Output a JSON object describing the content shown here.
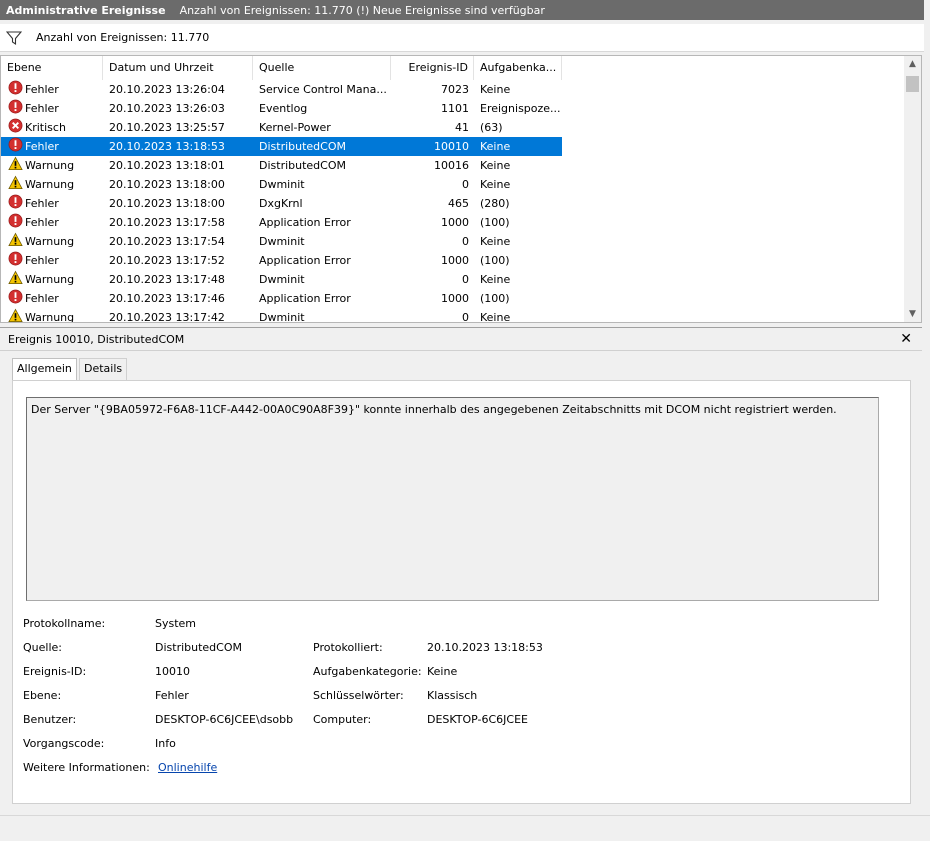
{
  "title": {
    "name": "Administrative Ereignisse",
    "info": "Anzahl von Ereignissen: 11.770 (!) Neue Ereignisse sind verfügbar"
  },
  "filter": {
    "icon": "filter-icon",
    "text": "Anzahl von Ereignissen: 11.770"
  },
  "columns": [
    "Ebene",
    "Datum und Uhrzeit",
    "Quelle",
    "Ereignis-ID",
    "Aufgabenka..."
  ],
  "rows": [
    {
      "level": "Fehler",
      "icon": "error",
      "date": "20.10.2023 13:26:04",
      "source": "Service Control Mana...",
      "id": "7023",
      "task": "Keine"
    },
    {
      "level": "Fehler",
      "icon": "error",
      "date": "20.10.2023 13:26:03",
      "source": "Eventlog",
      "id": "1101",
      "task": "Ereignispoze..."
    },
    {
      "level": "Kritisch",
      "icon": "critical",
      "date": "20.10.2023 13:25:57",
      "source": "Kernel-Power",
      "id": "41",
      "task": "(63)"
    },
    {
      "level": "Fehler",
      "icon": "error",
      "date": "20.10.2023 13:18:53",
      "source": "DistributedCOM",
      "id": "10010",
      "task": "Keine",
      "selected": true
    },
    {
      "level": "Warnung",
      "icon": "warning",
      "date": "20.10.2023 13:18:01",
      "source": "DistributedCOM",
      "id": "10016",
      "task": "Keine"
    },
    {
      "level": "Warnung",
      "icon": "warning",
      "date": "20.10.2023 13:18:00",
      "source": "Dwminit",
      "id": "0",
      "task": "Keine"
    },
    {
      "level": "Fehler",
      "icon": "error",
      "date": "20.10.2023 13:18:00",
      "source": "DxgKrnl",
      "id": "465",
      "task": "(280)"
    },
    {
      "level": "Fehler",
      "icon": "error",
      "date": "20.10.2023 13:17:58",
      "source": "Application Error",
      "id": "1000",
      "task": "(100)"
    },
    {
      "level": "Warnung",
      "icon": "warning",
      "date": "20.10.2023 13:17:54",
      "source": "Dwminit",
      "id": "0",
      "task": "Keine"
    },
    {
      "level": "Fehler",
      "icon": "error",
      "date": "20.10.2023 13:17:52",
      "source": "Application Error",
      "id": "1000",
      "task": "(100)"
    },
    {
      "level": "Warnung",
      "icon": "warning",
      "date": "20.10.2023 13:17:48",
      "source": "Dwminit",
      "id": "0",
      "task": "Keine"
    },
    {
      "level": "Fehler",
      "icon": "error",
      "date": "20.10.2023 13:17:46",
      "source": "Application Error",
      "id": "1000",
      "task": "(100)"
    },
    {
      "level": "Warnung",
      "icon": "warning",
      "date": "20.10.2023 13:17:42",
      "source": "Dwminit",
      "id": "0",
      "task": "Keine"
    }
  ],
  "detail": {
    "header": "Ereignis 10010, DistributedCOM",
    "tabs": [
      "Allgemein",
      "Details"
    ],
    "message": "Der Server \"{9BA05972-F6A8-11CF-A442-00A0C90A8F39}\" konnte innerhalb des angegebenen Zeitabschnitts mit DCOM nicht registriert werden.",
    "props": {
      "logname_label": "Protokollname:",
      "logname": "System",
      "source_label": "Quelle:",
      "source": "DistributedCOM",
      "logged_label": "Protokolliert:",
      "logged": "20.10.2023 13:18:53",
      "eventid_label": "Ereignis-ID:",
      "eventid": "10010",
      "taskcat_label": "Aufgabenkategorie:",
      "taskcat": "Keine",
      "level_label": "Ebene:",
      "level": "Fehler",
      "keywords_label": "Schlüsselwörter:",
      "keywords": "Klassisch",
      "user_label": "Benutzer:",
      "user": "DESKTOP-6C6JCEE\\dsobb",
      "computer_label": "Computer:",
      "computer": "DESKTOP-6C6JCEE",
      "opcode_label": "Vorgangscode:",
      "opcode": "Info",
      "moreinfo_label": "Weitere Informationen:",
      "moreinfo_link": "Onlinehilfe"
    }
  },
  "colors": {
    "selection": "#0078d7",
    "error": "#d32f2f",
    "warning": "#f3c300",
    "link": "#0645ad"
  }
}
